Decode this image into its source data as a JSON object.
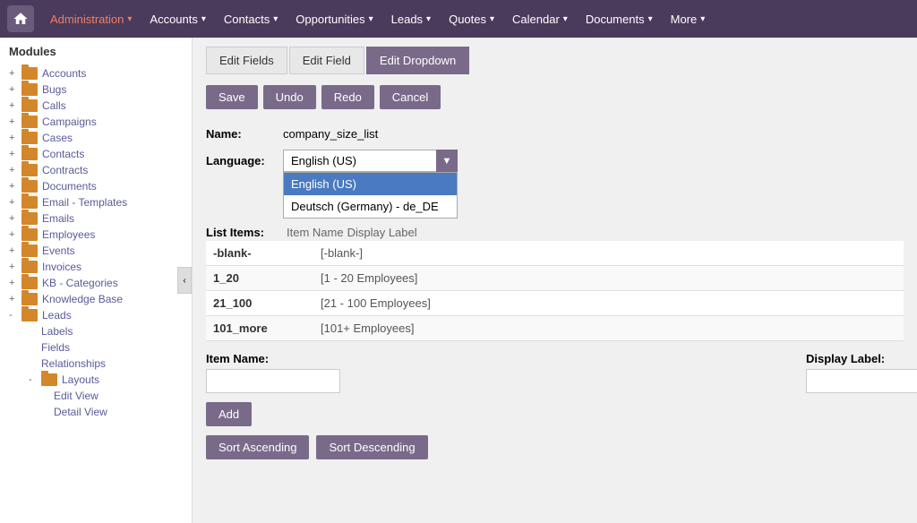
{
  "nav": {
    "home_icon": "⌂",
    "items": [
      {
        "label": "Administration",
        "has_arrow": true,
        "active": true
      },
      {
        "label": "Accounts",
        "has_arrow": true,
        "active": false
      },
      {
        "label": "Contacts",
        "has_arrow": true,
        "active": false
      },
      {
        "label": "Opportunities",
        "has_arrow": true,
        "active": false
      },
      {
        "label": "Leads",
        "has_arrow": true,
        "active": false
      },
      {
        "label": "Quotes",
        "has_arrow": true,
        "active": false
      },
      {
        "label": "Calendar",
        "has_arrow": true,
        "active": false
      },
      {
        "label": "Documents",
        "has_arrow": true,
        "active": false
      },
      {
        "label": "More",
        "has_arrow": true,
        "active": false
      }
    ]
  },
  "sidebar": {
    "modules_label": "Modules",
    "items": [
      {
        "label": "Accounts",
        "expanded": false,
        "indent": 0,
        "has_expand": true
      },
      {
        "label": "Bugs",
        "expanded": false,
        "indent": 0,
        "has_expand": true
      },
      {
        "label": "Calls",
        "expanded": false,
        "indent": 0,
        "has_expand": true
      },
      {
        "label": "Campaigns",
        "expanded": false,
        "indent": 0,
        "has_expand": true
      },
      {
        "label": "Cases",
        "expanded": false,
        "indent": 0,
        "has_expand": true
      },
      {
        "label": "Contacts",
        "expanded": false,
        "indent": 0,
        "has_expand": true
      },
      {
        "label": "Contracts",
        "expanded": false,
        "indent": 0,
        "has_expand": true
      },
      {
        "label": "Documents",
        "expanded": false,
        "indent": 0,
        "has_expand": true
      },
      {
        "label": "Email - Templates",
        "expanded": false,
        "indent": 0,
        "has_expand": true
      },
      {
        "label": "Emails",
        "expanded": false,
        "indent": 0,
        "has_expand": true
      },
      {
        "label": "Employees",
        "expanded": false,
        "indent": 0,
        "has_expand": true
      },
      {
        "label": "Events",
        "expanded": false,
        "indent": 0,
        "has_expand": true
      },
      {
        "label": "Invoices",
        "expanded": false,
        "indent": 0,
        "has_expand": true
      },
      {
        "label": "KB - Categories",
        "expanded": false,
        "indent": 0,
        "has_expand": true
      },
      {
        "label": "Knowledge Base",
        "expanded": false,
        "indent": 0,
        "has_expand": true
      },
      {
        "label": "Leads",
        "expanded": true,
        "indent": 0,
        "has_expand": true
      },
      {
        "label": "Labels",
        "expanded": false,
        "indent": 1,
        "has_expand": false
      },
      {
        "label": "Fields",
        "expanded": false,
        "indent": 1,
        "has_expand": false
      },
      {
        "label": "Relationships",
        "expanded": false,
        "indent": 1,
        "has_expand": false
      },
      {
        "label": "Layouts",
        "expanded": true,
        "indent": 1,
        "has_expand": true
      },
      {
        "label": "Edit View",
        "expanded": false,
        "indent": 2,
        "has_expand": false
      },
      {
        "label": "Detail View",
        "expanded": false,
        "indent": 2,
        "has_expand": false
      }
    ]
  },
  "tabs": [
    {
      "label": "Edit Fields",
      "active": false
    },
    {
      "label": "Edit Field",
      "active": false
    },
    {
      "label": "Edit Dropdown",
      "active": true
    }
  ],
  "toolbar": {
    "save_label": "Save",
    "undo_label": "Undo",
    "redo_label": "Redo",
    "cancel_label": "Cancel"
  },
  "form": {
    "name_label": "Name:",
    "name_value": "company_size_list",
    "language_label": "Language:",
    "language_selected": "English (US)",
    "language_options": [
      {
        "label": "English (US)",
        "selected": true
      },
      {
        "label": "Deutsch (Germany) - de_DE",
        "selected": false
      }
    ],
    "list_items_label": "List Items:",
    "item_name_header": "Item Name",
    "display_label_header": "Display Label",
    "items": [
      {
        "name": "-blank-",
        "display": "[-blank-]"
      },
      {
        "name": "1_20",
        "display": "[1 - 20 Employees]"
      },
      {
        "name": "21_100",
        "display": "[21 - 100 Employees]"
      },
      {
        "name": "101_more",
        "display": "[101+ Employees]"
      }
    ],
    "bottom_item_name_label": "Item Name:",
    "bottom_display_label": "Display Label:",
    "add_btn_label": "Add",
    "sort_asc_label": "Sort Ascending",
    "sort_desc_label": "Sort Descending"
  }
}
